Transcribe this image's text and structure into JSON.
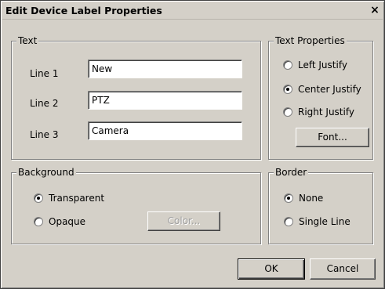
{
  "dialog": {
    "title": "Edit Device Label Properties",
    "close_glyph": "×",
    "text_group": {
      "legend": "Text",
      "line1_label": "Line 1",
      "line1_value": "New",
      "line2_label": "Line 2",
      "line2_value": "PTZ",
      "line3_label": "Line 3",
      "line3_value": "Camera"
    },
    "text_properties": {
      "legend": "Text Properties",
      "left_justify": "Left Justify",
      "center_justify": "Center Justify",
      "right_justify": "Right Justify",
      "selected": "Center Justify",
      "font_button": "Font..."
    },
    "background": {
      "legend": "Background",
      "transparent": "Transparent",
      "opaque": "Opaque",
      "selected": "Transparent",
      "color_button": "Color..."
    },
    "border": {
      "legend": "Border",
      "none": "None",
      "single_line": "Single Line",
      "selected": "None"
    },
    "buttons": {
      "ok": "OK",
      "cancel": "Cancel"
    },
    "colors": {
      "face": "#d4d0c8",
      "shadow": "#808080",
      "highlight": "#ffffff"
    }
  }
}
